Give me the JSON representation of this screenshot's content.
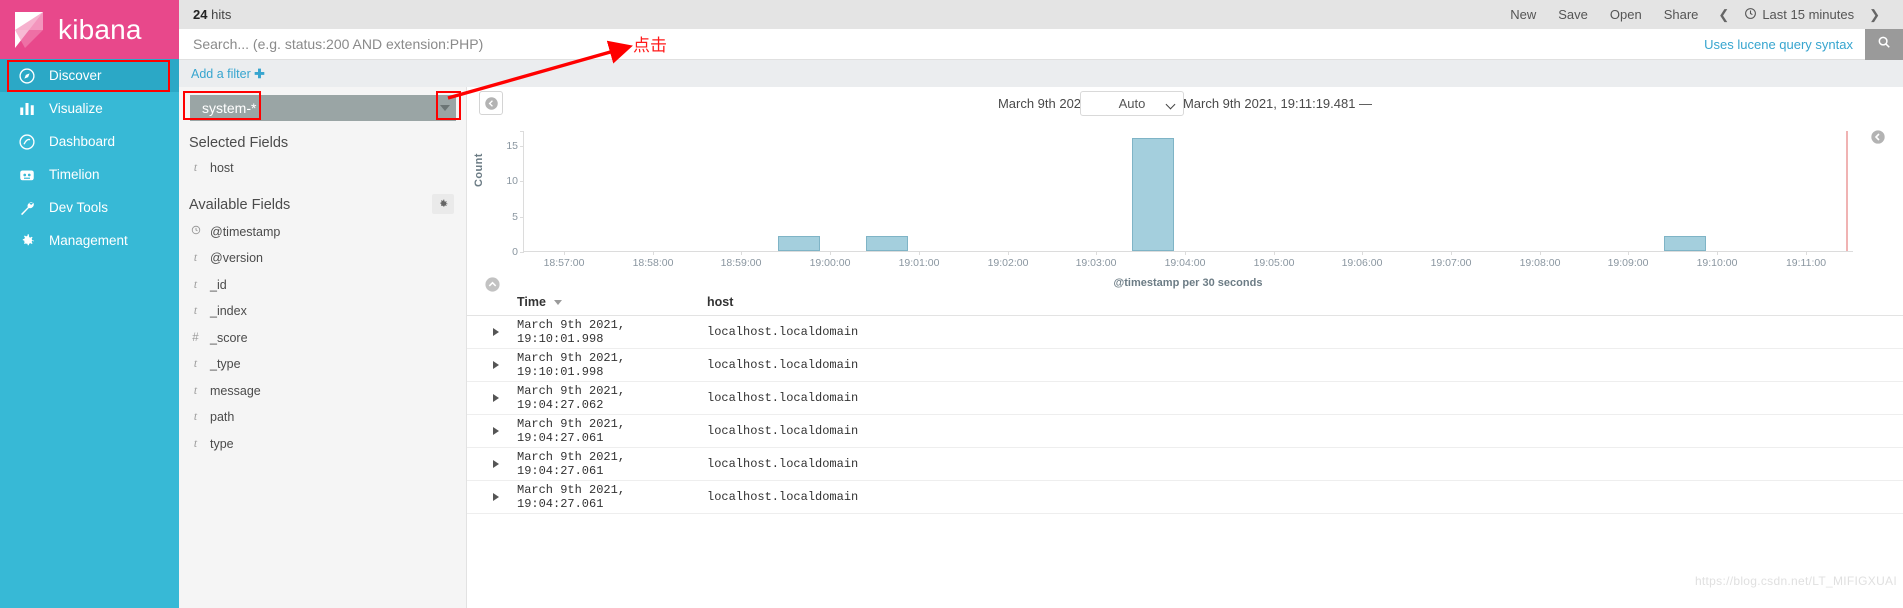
{
  "brand": {
    "name": "kibana",
    "logo_icon": "kibana-logo-icon"
  },
  "sidebar": {
    "items": [
      {
        "label": "Discover",
        "icon": "compass-icon",
        "active": true
      },
      {
        "label": "Visualize",
        "icon": "bar-chart-icon",
        "active": false
      },
      {
        "label": "Dashboard",
        "icon": "dashboard-icon",
        "active": false
      },
      {
        "label": "Timelion",
        "icon": "timelion-icon",
        "active": false
      },
      {
        "label": "Dev Tools",
        "icon": "wrench-icon",
        "active": false
      },
      {
        "label": "Management",
        "icon": "gear-icon",
        "active": false
      }
    ]
  },
  "topbar": {
    "hits_count": "24",
    "hits_label": "hits",
    "actions": [
      "New",
      "Save",
      "Open",
      "Share"
    ],
    "prev_icon": "chevron-left-icon",
    "next_icon": "chevron-right-icon",
    "clock_icon": "clock-icon",
    "time_picker_label": "Last 15 minutes"
  },
  "query": {
    "value": "",
    "placeholder": "Search... (e.g. status:200 AND extension:PHP)",
    "hint": "Uses lucene query syntax",
    "search_icon": "search-icon"
  },
  "filters": {
    "add_filter_label": "Add a filter",
    "add_icon": "plus-icon"
  },
  "left_panel": {
    "index_pattern": "system-*",
    "index_pattern_caret_icon": "caret-down-icon",
    "selected_fields_title": "Selected Fields",
    "selected_fields": [
      {
        "name": "host",
        "type": "t"
      }
    ],
    "available_fields_title": "Available Fields",
    "settings_icon": "gear-icon",
    "available_fields": [
      {
        "name": "@timestamp",
        "type": "clock"
      },
      {
        "name": "@version",
        "type": "t"
      },
      {
        "name": "_id",
        "type": "t"
      },
      {
        "name": "_index",
        "type": "t"
      },
      {
        "name": "_score",
        "type": "#"
      },
      {
        "name": "_type",
        "type": "t"
      },
      {
        "name": "message",
        "type": "t"
      },
      {
        "name": "path",
        "type": "t"
      },
      {
        "name": "type",
        "type": "t"
      }
    ]
  },
  "chart_header": {
    "collapse_icon": "chevron-left-circle-icon",
    "time_range_text": "March 9th 2021, 18:56:19.481 - March 9th 2021, 19:11:19.481 —",
    "interval_value": "Auto",
    "interval_caret_icon": "chevron-down-icon",
    "right_collapse_icon": "chevron-left-circle-icon",
    "expand_icon": "chevron-up-circle-icon"
  },
  "chart_data": {
    "type": "bar",
    "title": "",
    "xlabel": "@timestamp per 30 seconds",
    "ylabel": "Count",
    "ylim": [
      0,
      17
    ],
    "yticks": [
      0,
      5,
      10,
      15
    ],
    "grid": false,
    "legend": "none",
    "x_axis_range": [
      "18:56:19",
      "19:11:19"
    ],
    "xticks": [
      "18:57:00",
      "18:58:00",
      "18:59:00",
      "19:00:00",
      "19:01:00",
      "19:02:00",
      "19:03:00",
      "19:04:00",
      "19:05:00",
      "19:06:00",
      "19:07:00",
      "19:08:00",
      "19:09:00",
      "19:10:00",
      "19:11:00"
    ],
    "categories": [
      "19:00:00",
      "19:01:00",
      "19:04:00",
      "19:10:00"
    ],
    "values": [
      2,
      2,
      16,
      2
    ],
    "bar_color": "#a4cfdd",
    "now_marker": "19:11:19.481"
  },
  "doc_table": {
    "columns": [
      "Time",
      "host"
    ],
    "sort_icon": "caret-down-icon",
    "expand_row_icon": "caret-right-icon",
    "rows": [
      {
        "time": "March 9th 2021, 19:10:01.998",
        "host": "localhost.localdomain"
      },
      {
        "time": "March 9th 2021, 19:10:01.998",
        "host": "localhost.localdomain"
      },
      {
        "time": "March 9th 2021, 19:04:27.062",
        "host": "localhost.localdomain"
      },
      {
        "time": "March 9th 2021, 19:04:27.061",
        "host": "localhost.localdomain"
      },
      {
        "time": "March 9th 2021, 19:04:27.061",
        "host": "localhost.localdomain"
      },
      {
        "time": "March 9th 2021, 19:04:27.061",
        "host": "localhost.localdomain"
      }
    ]
  },
  "annotations": {
    "click_note": "点击",
    "highlight_color": "#ff0000",
    "watermark": "https://blog.csdn.net/LT_MIFIGXUAI"
  }
}
